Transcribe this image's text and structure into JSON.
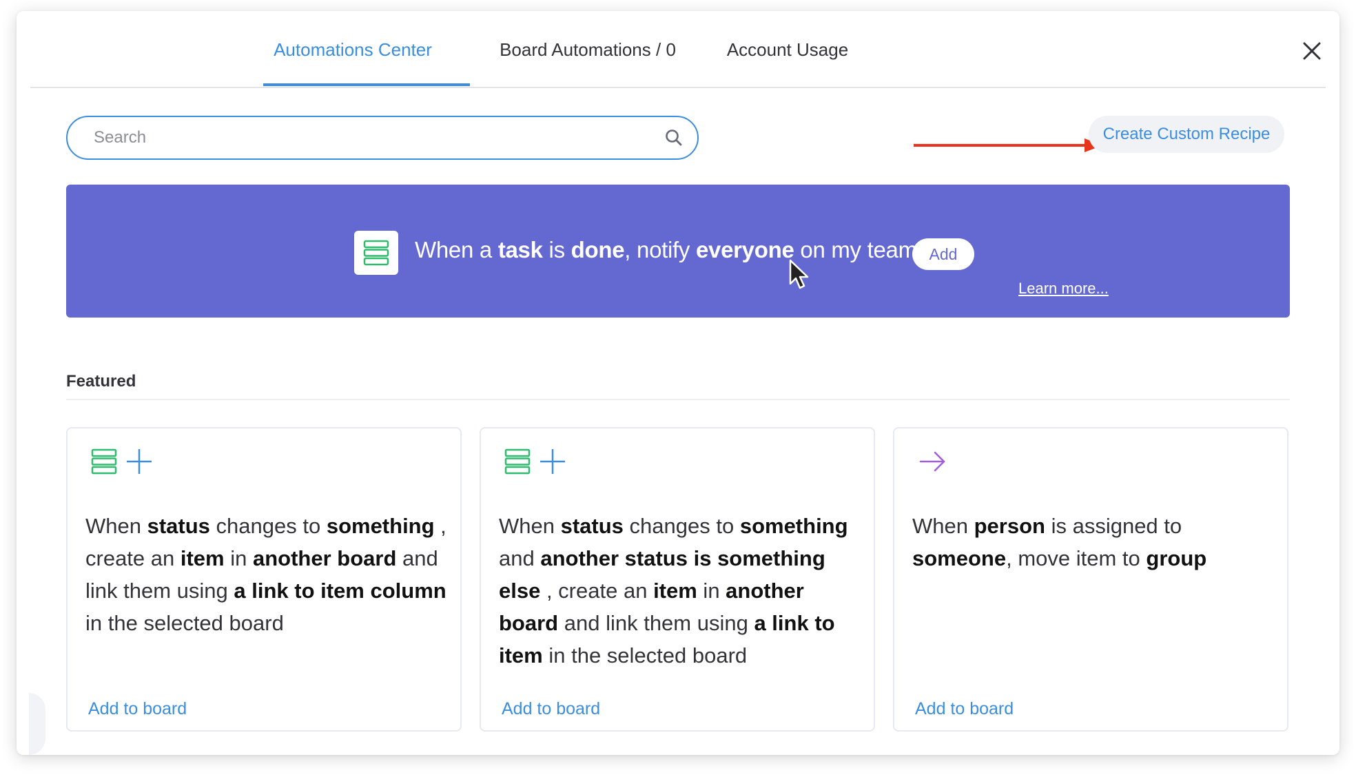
{
  "tabs": [
    {
      "label": "Automations Center",
      "active": true
    },
    {
      "label": "Board Automations / 0",
      "active": false
    },
    {
      "label": "Account Usage",
      "active": false
    }
  ],
  "search": {
    "placeholder": "Search",
    "value": ""
  },
  "custom_recipe_label": "Create Custom Recipe",
  "banner": {
    "when": "When a",
    "task": "task",
    "is": "is",
    "done": "done",
    "notify": ", notify",
    "everyone": "everyone",
    "rest": "on my team",
    "add_label": "Add",
    "learn_more": "Learn more..."
  },
  "featured_title": "Featured",
  "cards": [
    {
      "icons": [
        "board-icon",
        "plus-icon"
      ],
      "segments": [
        {
          "t": "When ",
          "b": false
        },
        {
          "t": "status",
          "b": true
        },
        {
          "t": " changes to ",
          "b": false
        },
        {
          "t": "something",
          "b": true
        },
        {
          "t": " , create an ",
          "b": false
        },
        {
          "t": "item",
          "b": true
        },
        {
          "t": " in ",
          "b": false
        },
        {
          "t": "another board",
          "b": true
        },
        {
          "t": " and link them using ",
          "b": false
        },
        {
          "t": "a link to item column",
          "b": true
        },
        {
          "t": " in the selected board",
          "b": false
        }
      ],
      "action_label": "Add to board"
    },
    {
      "icons": [
        "board-icon",
        "plus-icon"
      ],
      "segments": [
        {
          "t": "When ",
          "b": false
        },
        {
          "t": "status",
          "b": true
        },
        {
          "t": " changes to ",
          "b": false
        },
        {
          "t": "something",
          "b": true
        },
        {
          "t": " and ",
          "b": false
        },
        {
          "t": "another status",
          "b": true
        },
        {
          "t": " ",
          "b": false
        },
        {
          "t": "is",
          "b": true
        },
        {
          "t": " ",
          "b": false
        },
        {
          "t": "something else",
          "b": true
        },
        {
          "t": " , create an ",
          "b": false
        },
        {
          "t": "item",
          "b": true
        },
        {
          "t": " in ",
          "b": false
        },
        {
          "t": "another board",
          "b": true
        },
        {
          "t": " and link them using ",
          "b": false
        },
        {
          "t": "a link to item",
          "b": true
        },
        {
          "t": " in the selected board",
          "b": false
        }
      ],
      "action_label": "Add to board"
    },
    {
      "icons": [
        "arrow-right-icon"
      ],
      "segments": [
        {
          "t": "When ",
          "b": false
        },
        {
          "t": "person",
          "b": true
        },
        {
          "t": " is assigned to ",
          "b": false
        },
        {
          "t": "someone",
          "b": true
        },
        {
          "t": ", move item to ",
          "b": false
        },
        {
          "t": "group",
          "b": true
        }
      ],
      "action_label": "Add to board"
    }
  ],
  "colors": {
    "accent": "#3a8de0",
    "banner": "#6469d2",
    "board_icon_green": "#2fbb6e",
    "arrow_purple": "#a25ddc",
    "annotation_red": "#e8341c"
  }
}
